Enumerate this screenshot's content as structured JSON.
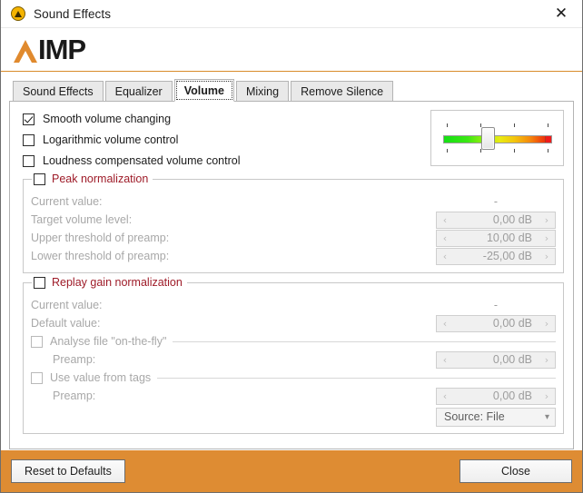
{
  "window": {
    "title": "Sound Effects",
    "app_icon": "aimp-logo-icon",
    "close_icon": "close-icon"
  },
  "brand": {
    "logo_text": "IMP",
    "accent_color": "#e08a2e"
  },
  "tabs": [
    {
      "label": "Sound Effects",
      "active": false
    },
    {
      "label": "Equalizer",
      "active": false
    },
    {
      "label": "Volume",
      "active": true
    },
    {
      "label": "Mixing",
      "active": false
    },
    {
      "label": "Remove Silence",
      "active": false
    }
  ],
  "options": {
    "smooth_volume": {
      "label": "Smooth volume changing",
      "checked": true,
      "enabled": true
    },
    "logarithmic": {
      "label": "Logarithmic volume control",
      "checked": false,
      "enabled": true
    },
    "loudness": {
      "label": "Loudness compensated volume control",
      "checked": false,
      "enabled": true
    }
  },
  "volume_slider": {
    "name": "volume-balance-slider",
    "thumb_position_percent": 38,
    "gradient_start": "#14e014",
    "gradient_end": "#ee1111",
    "tick_count": 4
  },
  "peak_normalization": {
    "title": "Peak normalization",
    "checked": false,
    "title_color": "#9e1b28",
    "rows": [
      {
        "label": "Current value:",
        "type": "text",
        "value": "-"
      },
      {
        "label": "Target volume level:",
        "type": "spinner",
        "value": "0,00 dB"
      },
      {
        "label": "Upper threshold of preamp:",
        "type": "spinner",
        "value": "10,00 dB"
      },
      {
        "label": "Lower threshold of preamp:",
        "type": "spinner",
        "value": "-25,00 dB"
      }
    ]
  },
  "replay_gain": {
    "title": "Replay gain normalization",
    "checked": false,
    "title_color": "#9e1b28",
    "rows": [
      {
        "label": "Current value:",
        "type": "text",
        "value": "-"
      },
      {
        "label": "Default value:",
        "type": "spinner",
        "value": "0,00 dB"
      }
    ],
    "analyse_on_the_fly": {
      "label": "Analyse file \"on-the-fly\"",
      "checked": false,
      "preamp_label": "Preamp:",
      "preamp_value": "0,00 dB"
    },
    "use_value_from_tags": {
      "label": "Use value from tags",
      "checked": false,
      "preamp_label": "Preamp:",
      "preamp_value": "0,00 dB"
    },
    "source_combo": {
      "value": "Source: File",
      "chevron": "chevron-down-icon"
    }
  },
  "spinner_glyphs": {
    "prev": "‹",
    "next": "›"
  },
  "footer": {
    "background": "#de8c33",
    "reset_label": "Reset to Defaults",
    "close_label": "Close"
  }
}
